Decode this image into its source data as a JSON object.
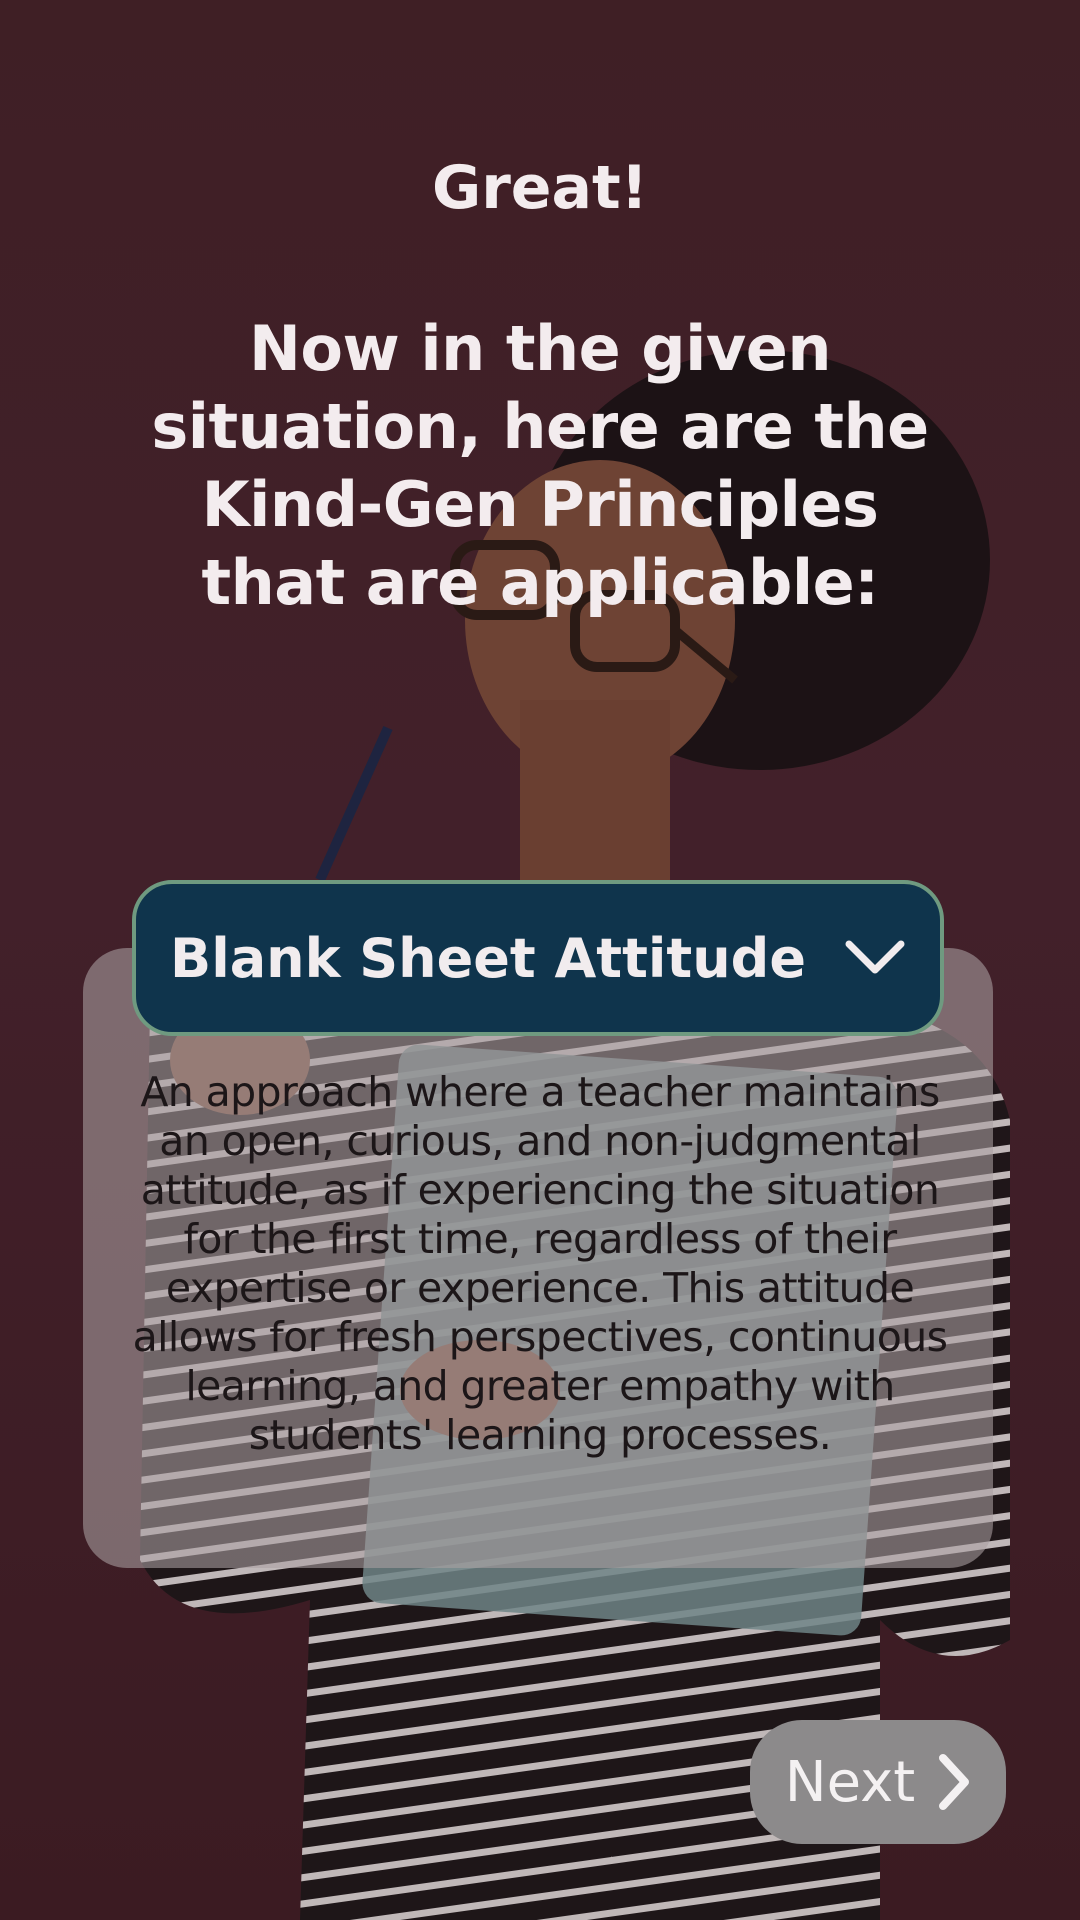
{
  "header": {
    "greeting": "Great!",
    "prompt": "Now in the given situation, here are the Kind-Gen Principles that are applicable:"
  },
  "principle": {
    "selected": "Blank Sheet Attitude",
    "description": "An approach where a teacher maintains an open, curious, and non-judgmental attitude, as if experiencing the situation for the first time, regardless of their expertise or experience. This attitude allows for fresh perspectives, continuous learning, and greater empathy with students' learning processes."
  },
  "navigation": {
    "next_label": "Next"
  },
  "colors": {
    "background": "#3f1f25",
    "dropdown": "#0f344c",
    "dropdown_border": "#6f9a80",
    "card": "#aaa0a2",
    "next_button": "#8c8a8b"
  },
  "icons": {
    "dropdown": "chevron-down-icon",
    "next": "chevron-right-icon"
  }
}
